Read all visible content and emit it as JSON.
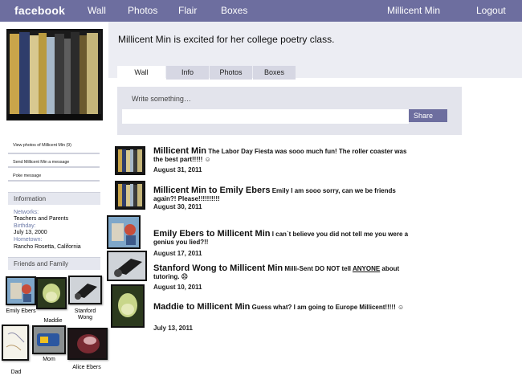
{
  "nav": {
    "logo": "facebook",
    "links": [
      "Wall",
      "Photos",
      "Flair",
      "Boxes"
    ],
    "user": "Millicent Min",
    "logout": "Logout"
  },
  "status": {
    "name": "Millicent Min",
    "text": " is excited for her college poetry class."
  },
  "sidebar": {
    "links": [
      "View photos of Millicent Min (9)",
      "Send Millicent Min a message",
      "Poke message"
    ],
    "info_heading": "Information",
    "info": [
      {
        "label": "Networks:",
        "value": "Teachers and Parents"
      },
      {
        "label": "Birthday:",
        "value": "July 13, 2000"
      },
      {
        "label": "Hometown:",
        "value": "Rancho Rosetta, California"
      }
    ],
    "friends_heading": "Friends and Family",
    "friends": [
      "Emily Ebers",
      "Maddie",
      "Stanford Wong",
      "Dad",
      "Mom",
      "Alice Ebers"
    ]
  },
  "tabs": [
    "Wall",
    "Info",
    "Photos",
    "Boxes"
  ],
  "composer": {
    "prompt": "Write something…",
    "share": "Share"
  },
  "posts": [
    {
      "author": "Millicent Min",
      "message": " The Labor Day Fiesta was sooo much fun! The roller coaster was the best part!!!!! ☺",
      "date": "August 31, 2011"
    },
    {
      "author": "Millicent Min to Emily Ebers",
      "message": " Emily I am sooo sorry, can we be friends again?! Please!!!!!!!!!!",
      "date": "August 30, 2011"
    },
    {
      "author": "Emily Ebers to Millicent Min",
      "message": " I can`t believe you did not tell me you were a genius you lied?!!",
      "date": "August 17, 2011"
    },
    {
      "author": "Stanford Wong to Millicent Min",
      "message_pre": " Milli-Sent DO NOT tell ",
      "message_emph": "ANYONE",
      "message_post": " about tutoring. ☹",
      "date": "August 10, 2011"
    },
    {
      "author": "Maddie to Millicent Min",
      "message": " Guess what? I am going to Europe Millicent!!!!! ☺",
      "date": "July 13, 2011"
    }
  ],
  "colors": {
    "topbar": "#6d6e9f",
    "panel": "#e3e4ec",
    "link_label": "#6c7aa8"
  }
}
